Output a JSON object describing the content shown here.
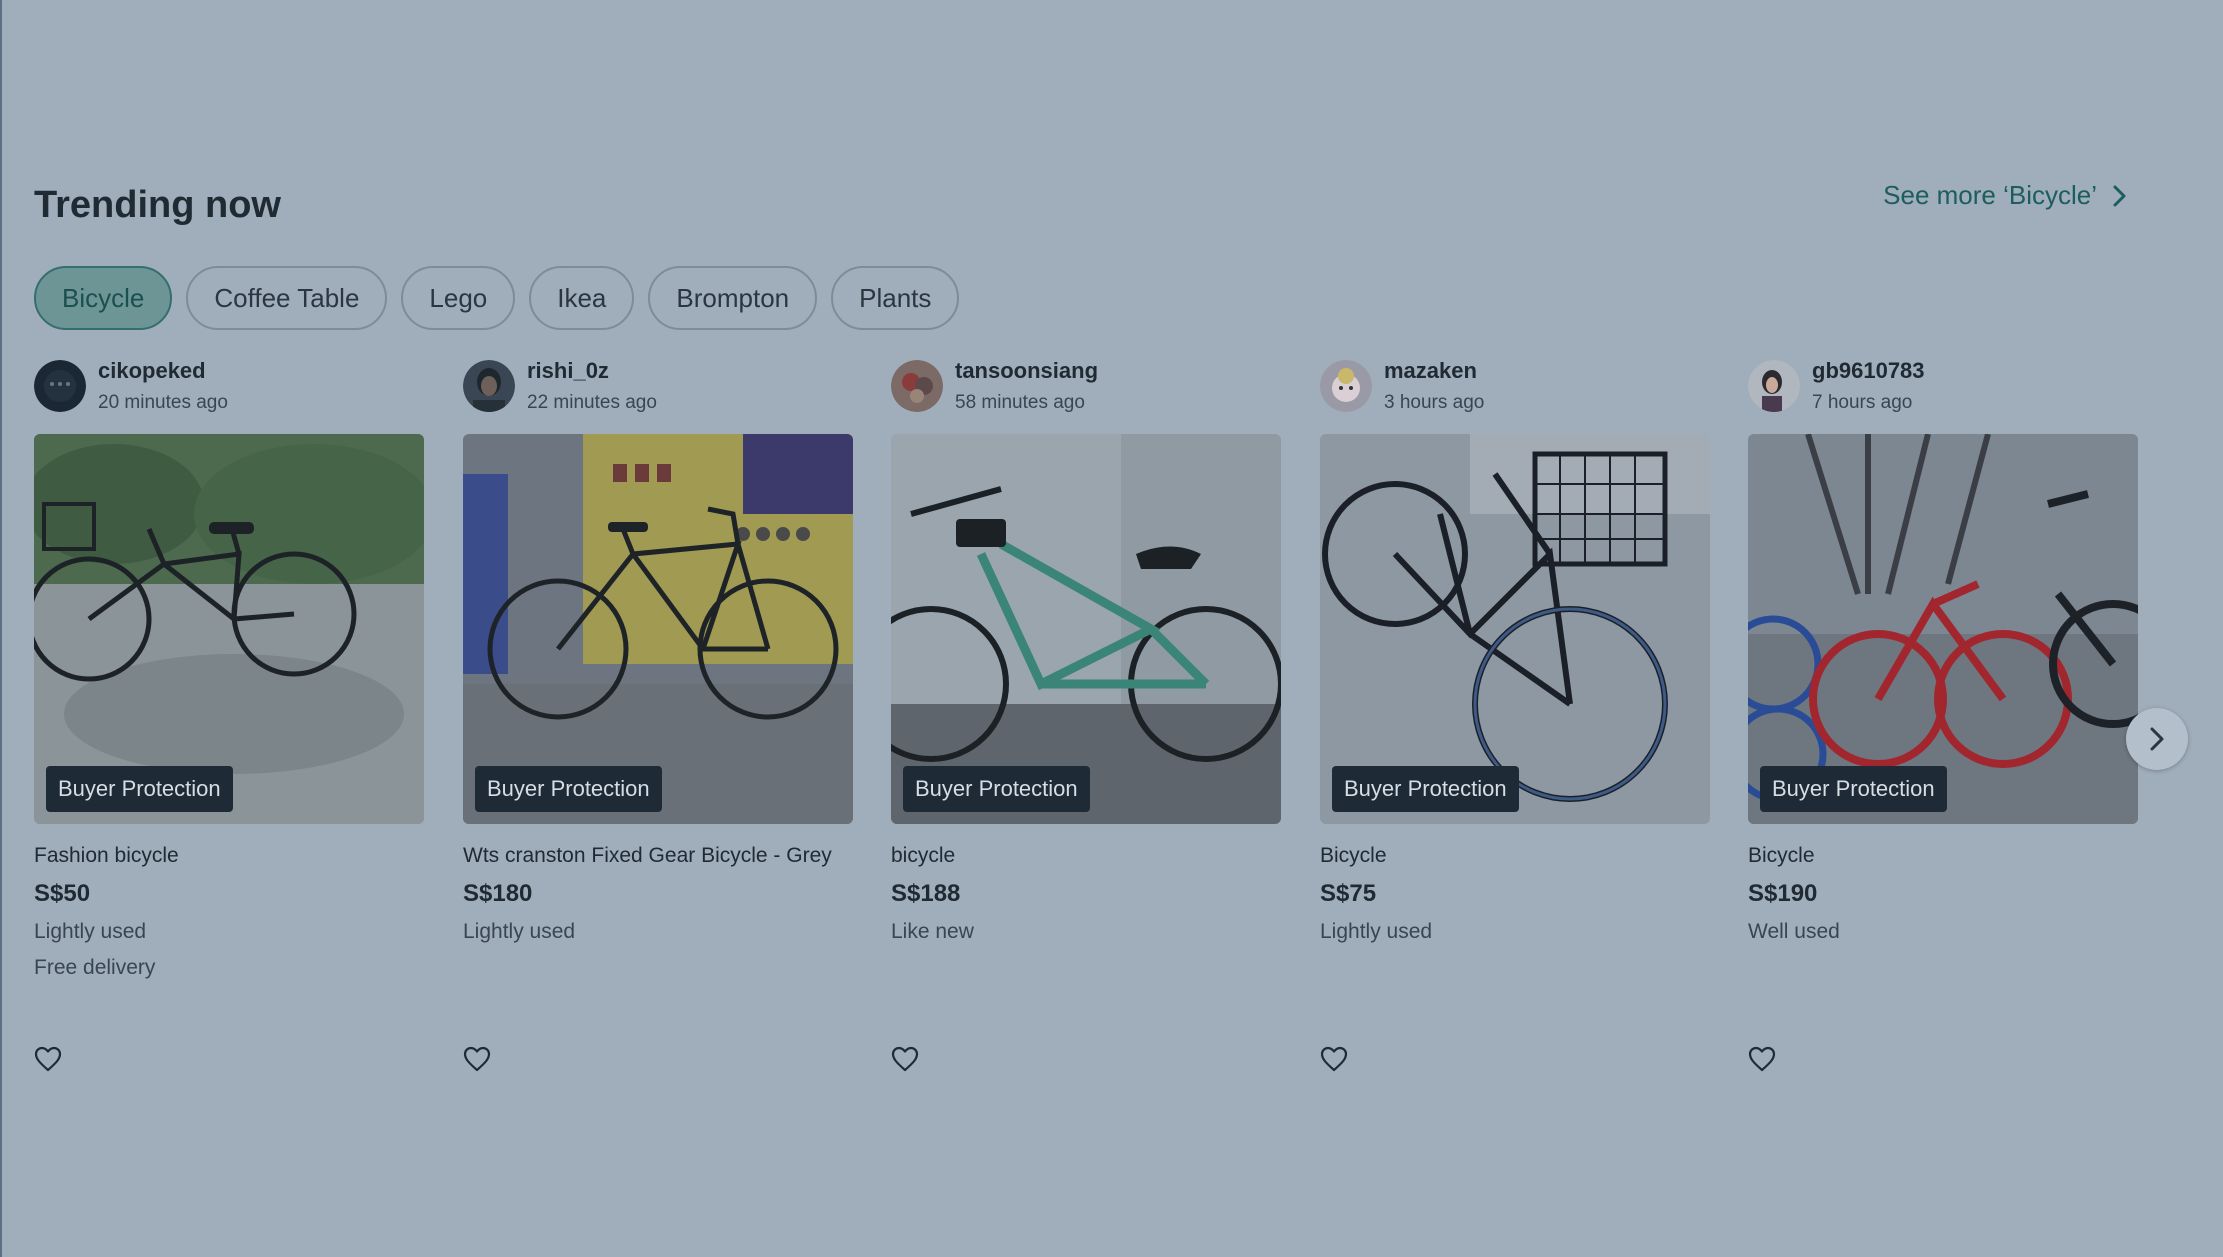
{
  "section": {
    "title": "Trending now",
    "see_more_label": "See more ‘Bicycle’"
  },
  "chips": [
    {
      "label": "Bicycle",
      "active": true
    },
    {
      "label": "Coffee Table",
      "active": false
    },
    {
      "label": "Lego",
      "active": false
    },
    {
      "label": "Ikea",
      "active": false
    },
    {
      "label": "Brompton",
      "active": false
    },
    {
      "label": "Plants",
      "active": false
    }
  ],
  "listings": [
    {
      "seller": "cikopeked",
      "time": "20 minutes ago",
      "badge": "Buyer Protection",
      "title": "Fashion bicycle",
      "price": "S$50",
      "condition": "Lightly used",
      "delivery": "Free delivery"
    },
    {
      "seller": "rishi_0z",
      "time": "22 minutes ago",
      "badge": "Buyer Protection",
      "title": "Wts cranston Fixed Gear Bicycle - Grey",
      "price": "S$180",
      "condition": "Lightly used"
    },
    {
      "seller": "tansoonsiang",
      "time": "58 minutes ago",
      "badge": "Buyer Protection",
      "title": "bicycle",
      "price": "S$188",
      "condition": "Like new"
    },
    {
      "seller": "mazaken",
      "time": "3 hours ago",
      "badge": "Buyer Protection",
      "title": "Bicycle",
      "price": "S$75",
      "condition": "Lightly used"
    },
    {
      "seller": "gb9610783",
      "time": "7 hours ago",
      "badge": "Buyer Protection",
      "title": "Bicycle",
      "price": "S$190",
      "condition": "Well used"
    }
  ],
  "colors": {
    "overlay_background": "#a0adbb",
    "accent_teal": "#1b5e5b",
    "active_chip": "#6d9596",
    "badge_background": "#1e2a36"
  },
  "icons": {
    "see_more": "chevron-right-icon",
    "like": "heart-outline-icon",
    "next": "chevron-right-icon"
  }
}
